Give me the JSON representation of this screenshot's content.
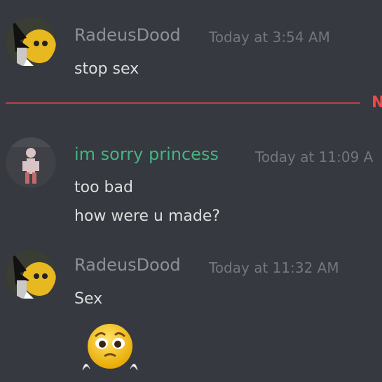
{
  "colors": {
    "background": "#36393f",
    "username_default": "#8e9297",
    "username_role": "#43b581",
    "timestamp": "#72767d",
    "message_text": "#dcddde",
    "new_divider": "#f04747"
  },
  "messages": [
    {
      "author": "RadeusDood",
      "timestamp": "Today at 3:54 AM",
      "lines": [
        "stop sex"
      ],
      "avatar_icon": "emoji-character-avatar-icon"
    },
    {
      "author": "im sorry princess",
      "timestamp": "Today at 11:09 A",
      "lines": [
        "too bad",
        "how were u made?"
      ],
      "avatar_icon": "figure-avatar-icon"
    },
    {
      "author": "RadeusDood",
      "timestamp": "Today at 11:32 AM",
      "lines": [
        "Sex"
      ],
      "avatar_icon": "emoji-character-avatar-icon",
      "attachment_icon": "pleading-face-emoji-icon"
    }
  ],
  "divider": {
    "label": "N"
  }
}
